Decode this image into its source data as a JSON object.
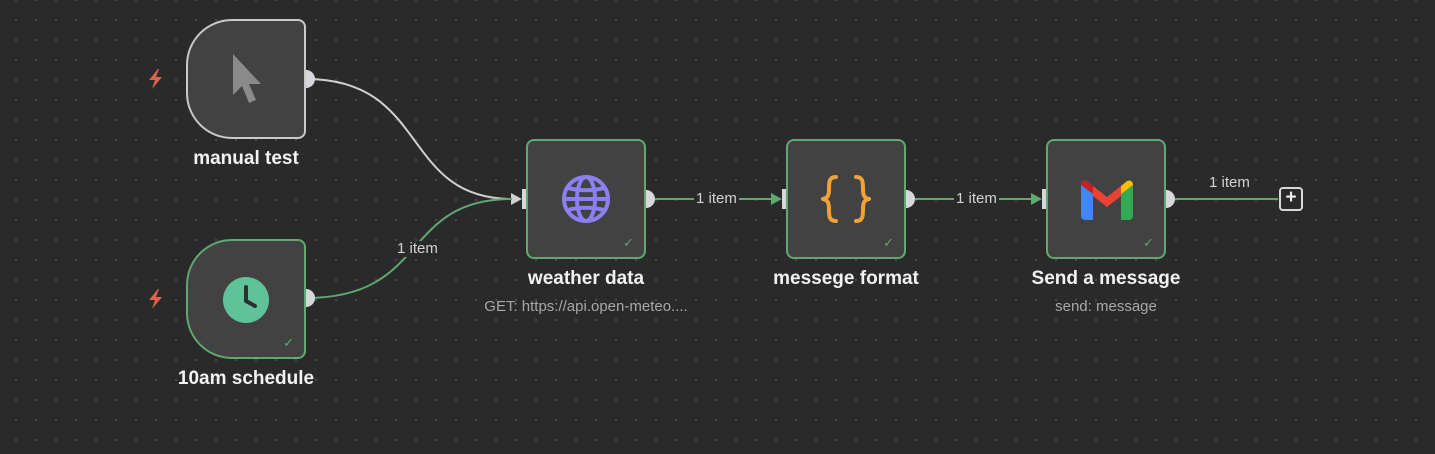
{
  "nodes": {
    "manual_test": {
      "label": "manual test",
      "icon": "cursor-icon"
    },
    "schedule": {
      "label": "10am schedule",
      "icon": "clock-icon",
      "status": "success"
    },
    "weather": {
      "label": "weather data",
      "subtitle": "GET: https://api.open-meteo....",
      "icon": "globe-icon",
      "status": "success"
    },
    "format": {
      "label": "messege format",
      "icon": "braces-icon",
      "status": "success"
    },
    "send": {
      "label": "Send a message",
      "subtitle": "send: message",
      "icon": "gmail-icon",
      "status": "success"
    }
  },
  "edges": {
    "schedule_to_weather": "1 item",
    "weather_to_format": "1 item",
    "format_to_send": "1 item",
    "send_output": "1 item"
  },
  "status_icons": {
    "success": "✓",
    "trigger": "lightning-bolt-icon"
  },
  "colors": {
    "canvas": "#2a2a2a",
    "node_fill": "#424242",
    "success_border": "#5fa870",
    "idle_border": "#c9c9c9",
    "connection_success": "#5fa870",
    "connection_idle": "#d0d0d0",
    "trigger_bolt": "#e0614f",
    "globe": "#8b7ff2",
    "braces": "#f0a23a",
    "clock": "#5fc29a"
  }
}
